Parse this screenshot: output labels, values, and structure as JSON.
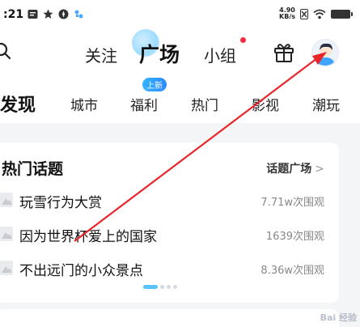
{
  "status": {
    "time": ":21",
    "speed_top": "4.90",
    "speed_bottom": "KB/s"
  },
  "top_nav": {
    "tabs": [
      "关注",
      "广场",
      "小组"
    ],
    "active_tab": "广场",
    "icons": [
      "search-icon",
      "gift-icon",
      "avatar"
    ]
  },
  "category_tabs": {
    "items": [
      "发现",
      "城市",
      "福利",
      "热门",
      "影视",
      "潮玩"
    ],
    "active": "发现",
    "badge": "上新"
  },
  "topic_card": {
    "title": "热门话题",
    "link_label": "话题广场",
    "link_chevron": ">",
    "topics": [
      {
        "name": "玩雪行为大赏",
        "views": "7.71w次围观"
      },
      {
        "name": "因为世界杯爱上的国家",
        "views": "1639次围观"
      },
      {
        "name": "不出远门的小众景点",
        "views": "8.36w次围观"
      }
    ],
    "page_count": 4,
    "page_active": 0
  },
  "colors": {
    "accent": "#2bb6ff",
    "notification": "#ff2b45",
    "annotation_arrow": "#e8262a"
  },
  "watermark": "Bai 经验"
}
